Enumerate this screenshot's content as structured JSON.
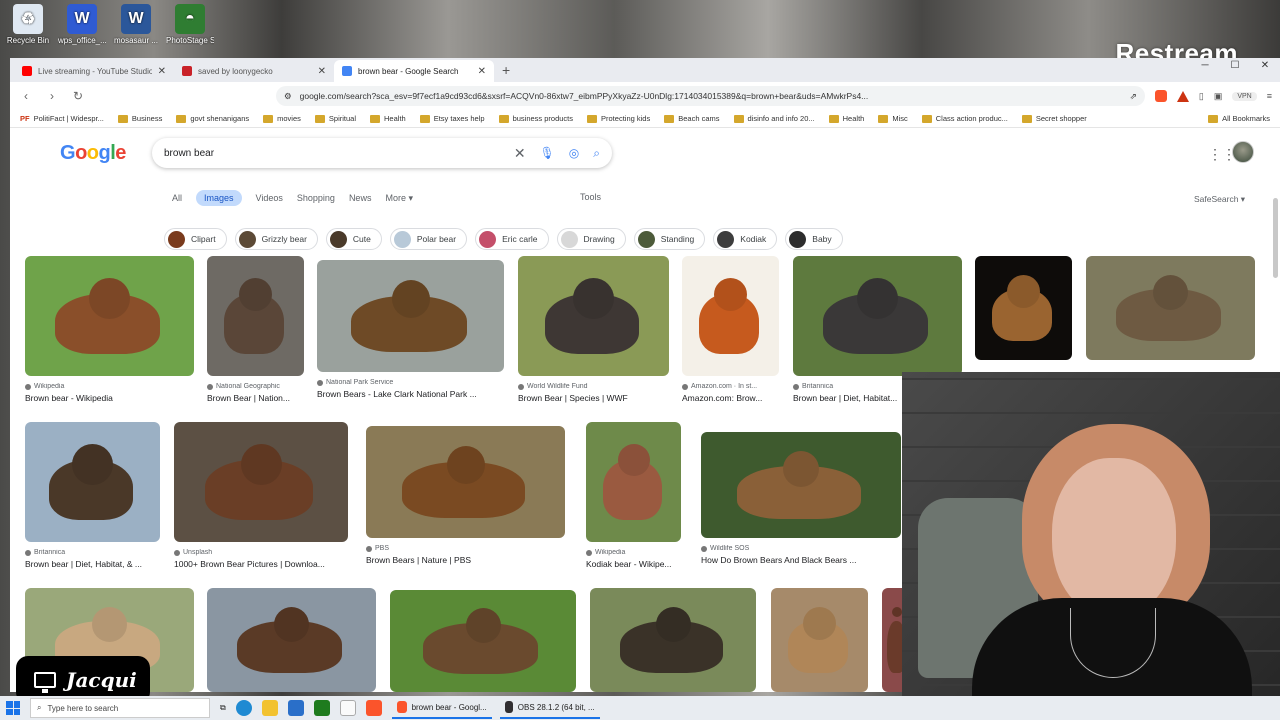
{
  "desktop": {
    "icons": [
      {
        "label": "Recycle Bin",
        "color": "#dfe8f2",
        "glyph": "♻"
      },
      {
        "label": "wps_office_...",
        "color": "#2f5bd3",
        "glyph": "W"
      },
      {
        "label": "mosasaur ...",
        "color": "#2b579a",
        "glyph": "W"
      },
      {
        "label": "PhotoStage Slideshow...",
        "color": "#2f7d32",
        "glyph": "◓"
      }
    ],
    "overlay_brand": "Restream"
  },
  "browser": {
    "tabs": [
      {
        "title": "Live streaming - YouTube Studio",
        "color": "#ff0000",
        "active": false
      },
      {
        "title": "saved by loonygecko",
        "color": "#c92228",
        "active": false
      },
      {
        "title": "brown bear - Google Search",
        "color": "#4285f4",
        "active": true
      }
    ],
    "url": "google.com/search?sca_esv=9f7ecf1a9cd93cd6&sxsrf=ACQVn0-86xtw7_eibmPPyXkyaZz-U0nDlg:1714034015389&q=brown+bear&uds=AMwkrPs4...",
    "vpn_label": "VPN",
    "bookmarks": [
      {
        "label": "PolitiFact | Widespr...",
        "folder": false
      },
      {
        "label": "Business",
        "folder": true
      },
      {
        "label": "govt shenanigans",
        "folder": true
      },
      {
        "label": "movies",
        "folder": true
      },
      {
        "label": "Spiritual",
        "folder": true
      },
      {
        "label": "Health",
        "folder": true
      },
      {
        "label": "Etsy taxes help",
        "folder": true
      },
      {
        "label": "business products",
        "folder": true
      },
      {
        "label": "Protecting kids",
        "folder": true
      },
      {
        "label": "Beach cams",
        "folder": true
      },
      {
        "label": "disinfo and info 20...",
        "folder": true
      },
      {
        "label": "Health",
        "folder": true
      },
      {
        "label": "Misc",
        "folder": true
      },
      {
        "label": "Class action produc...",
        "folder": true
      },
      {
        "label": "Secret shopper",
        "folder": true
      }
    ],
    "all_bookmarks": "All Bookmarks"
  },
  "google": {
    "logo": "Google",
    "query": "brown bear",
    "tabs": [
      "All",
      "Images",
      "Videos",
      "Shopping",
      "News",
      "More ▾"
    ],
    "active_tab": "Images",
    "tools": "Tools",
    "safesearch": "SafeSearch ▾",
    "chips": [
      {
        "label": "Clipart",
        "color": "#7a3b1d"
      },
      {
        "label": "Grizzly bear",
        "color": "#5c4a36"
      },
      {
        "label": "Cute",
        "color": "#4a3a2a"
      },
      {
        "label": "Polar bear",
        "color": "#b8c9d8"
      },
      {
        "label": "Eric carle",
        "color": "#c44f6a"
      },
      {
        "label": "Drawing",
        "color": "#d8d8d8"
      },
      {
        "label": "Standing",
        "color": "#4d5b3a"
      },
      {
        "label": "Kodiak",
        "color": "#3d3d3d"
      },
      {
        "label": "Baby",
        "color": "#2d2d2d"
      }
    ],
    "results": [
      {
        "source": "Wikipedia",
        "title": "Brown bear - Wikipedia",
        "bg": "#6fa34a",
        "fur": "#8a4f2a"
      },
      {
        "source": "National Geographic",
        "title": "Brown Bear | Nation...",
        "bg": "#6e6a64",
        "fur": "#5a4638"
      },
      {
        "source": "National Park Service",
        "title": "Brown Bears - Lake Clark National Park ...",
        "bg": "#9aa19d",
        "fur": "#6e4a26"
      },
      {
        "source": "World Wildlife Fund",
        "title": "Brown Bear | Species | WWF",
        "bg": "#8a9a56",
        "fur": "#3e3734"
      },
      {
        "source": "Amazon.com · In st...",
        "title": "Amazon.com: Brow...",
        "bg": "#f4f0e8",
        "fur": "#c65a1e"
      },
      {
        "source": "Britannica",
        "title": "Brown bear | Diet, Habitat...",
        "bg": "#5e7a3e",
        "fur": "#3a3838"
      },
      {
        "source": "",
        "title": "",
        "bg": "#0e0c0a",
        "fur": "#9a6430"
      },
      {
        "source": "",
        "title": "",
        "bg": "#7e7a5e",
        "fur": "#6e5a42"
      },
      {
        "source": "Britannica",
        "title": "Brown bear | Diet, Habitat, & ...",
        "bg": "#9bb0c4",
        "fur": "#4a3828"
      },
      {
        "source": "Unsplash",
        "title": "1000+ Brown Bear Pictures | Downloa...",
        "bg": "#5c5044",
        "fur": "#6a3e26"
      },
      {
        "source": "PBS",
        "title": "Brown Bears | Nature | PBS",
        "bg": "#8a7a56",
        "fur": "#7a4a22"
      },
      {
        "source": "Wikipedia",
        "title": "Kodiak bear - Wikipe...",
        "bg": "#6e8a4a",
        "fur": "#9a5a40"
      },
      {
        "source": "Wildlife SOS",
        "title": "How Do Brown Bears And Black Bears ...",
        "bg": "#3e5a2e",
        "fur": "#8a6038"
      },
      {
        "source": "",
        "title": "",
        "bg": "#9aa87a",
        "fur": "#c8a880"
      },
      {
        "source": "",
        "title": "",
        "bg": "#8a96a2",
        "fur": "#5a3a26"
      },
      {
        "source": "",
        "title": "",
        "bg": "#5a8a36",
        "fur": "#6a4a2e"
      },
      {
        "source": "",
        "title": "",
        "bg": "#7a8a5a",
        "fur": "#3a3228"
      },
      {
        "source": "",
        "title": "",
        "bg": "#a68a6a",
        "fur": "#b08658"
      },
      {
        "source": "",
        "title": "",
        "bg": "#8a4a4a",
        "fur": "#6a3a2a"
      }
    ]
  },
  "overlay": {
    "name_tag": "Jacqui"
  },
  "taskbar": {
    "search_placeholder": "Type here to search",
    "apps": [
      {
        "label": "brown bear - Googl...",
        "color": "#fb542b"
      },
      {
        "label": "OBS 28.1.2 (64 bit, ...",
        "color": "#302e31"
      }
    ]
  }
}
